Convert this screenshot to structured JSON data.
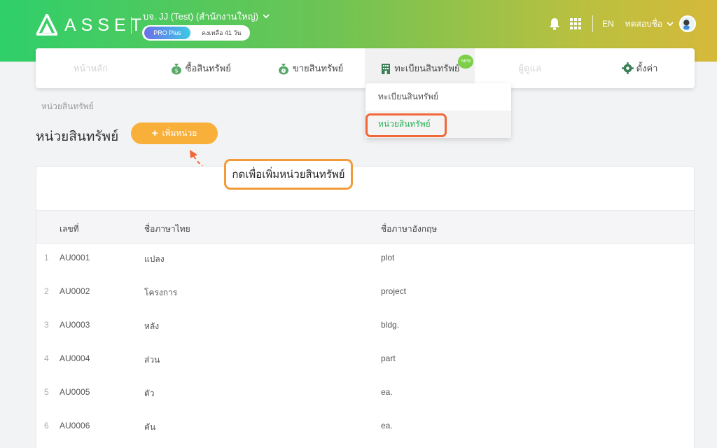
{
  "header": {
    "logo_text": "ASSET",
    "company": "บจ. JJ (Test) (สำนักงานใหญ่)",
    "plan_badge": "PRO Plus",
    "plan_remaining": "คงเหลือ 41 วัน",
    "lang": "EN",
    "user_name": "ทดสอบชื่อ"
  },
  "nav": {
    "items": [
      {
        "label": "หน้าหลัก",
        "icon": "home"
      },
      {
        "label": "ซื้อสินทรัพย์",
        "icon": "money-bag-icon"
      },
      {
        "label": "ขายสินทรัพย์",
        "icon": "money-bag-clock-icon"
      },
      {
        "label": "ทะเบียนสินทรัพย์",
        "icon": "building-icon",
        "badge": "NEW"
      },
      {
        "label": "ผู้ดูแล",
        "icon": "user"
      },
      {
        "label": "ตั้งค่า",
        "icon": "gear-icon"
      }
    ]
  },
  "dropdown": {
    "items": [
      "ทะเบียนสินทรัพย์",
      "หน่วยสินทรัพย์"
    ]
  },
  "breadcrumb": "หน่วยสินทรัพย์",
  "page_title": "หน่วยสินทรัพย์",
  "add_button": "เพิ่มหน่วย",
  "callout": "กดเพื่อเพิ่มหน่วยสินทรัพย์",
  "table": {
    "headers": [
      "เลขที่",
      "ชื่อภาษาไทย",
      "ชื่อภาษาอังกฤษ"
    ],
    "rows": [
      {
        "i": "1",
        "code": "AU0001",
        "th": "แปลง",
        "en": "plot"
      },
      {
        "i": "2",
        "code": "AU0002",
        "th": "โครงการ",
        "en": "project"
      },
      {
        "i": "3",
        "code": "AU0003",
        "th": "หลัง",
        "en": "bldg."
      },
      {
        "i": "4",
        "code": "AU0004",
        "th": "ส่วน",
        "en": "part"
      },
      {
        "i": "5",
        "code": "AU0005",
        "th": "ตัว",
        "en": "ea."
      },
      {
        "i": "6",
        "code": "AU0006",
        "th": "คัน",
        "en": "ea."
      }
    ]
  },
  "colors": {
    "accent_green": "#2fcf6a",
    "add_button": "#f9b03a",
    "highlight_outline": "#f0683a"
  }
}
